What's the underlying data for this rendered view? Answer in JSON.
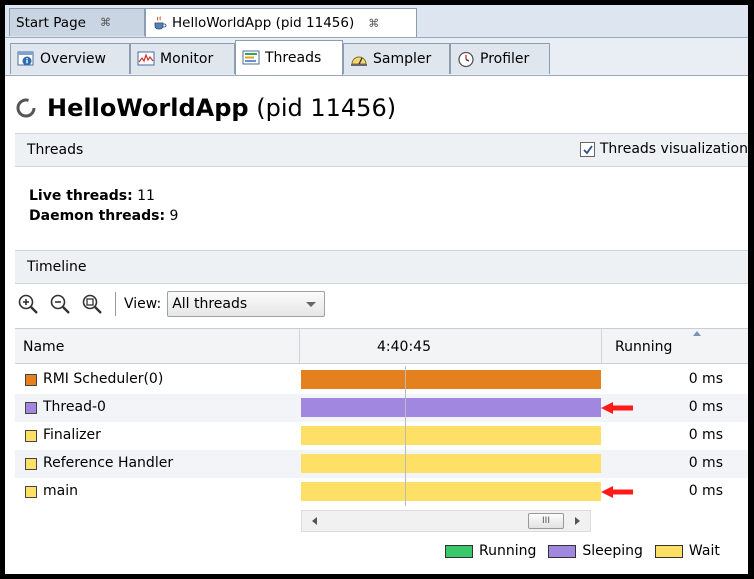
{
  "doc_tabs": [
    {
      "label": "Start Page",
      "active": false
    },
    {
      "label": "HelloWorldApp (pid 11456)",
      "active": true
    }
  ],
  "sub_tabs": [
    {
      "label": "Overview",
      "icon": "info-icon"
    },
    {
      "label": "Monitor",
      "icon": "monitor-chart-icon"
    },
    {
      "label": "Threads",
      "icon": "threads-icon",
      "active": true
    },
    {
      "label": "Sampler",
      "icon": "sampler-icon"
    },
    {
      "label": "Profiler",
      "icon": "profiler-clock-icon"
    }
  ],
  "app": {
    "name": "HelloWorldApp",
    "pid": "(pid 11456)"
  },
  "threads_section": {
    "title": "Threads",
    "checkbox_label": "Threads visualization",
    "checkbox_checked": true
  },
  "stats": {
    "live_label": "Live threads:",
    "live_value": "11",
    "daemon_label": "Daemon threads:",
    "daemon_value": "9"
  },
  "timeline": {
    "title": "Timeline",
    "view_label": "View:",
    "view_value": "All threads"
  },
  "table": {
    "col_name": "Name",
    "col_time": "4:40:45",
    "col_running": "Running",
    "rows": [
      {
        "name": "RMI Scheduler(0)",
        "color": "#e5801e",
        "running": "0 ms",
        "state": "Park"
      },
      {
        "name": "Thread-0",
        "color": "#a287e0",
        "running": "0 ms",
        "state": "Sleeping"
      },
      {
        "name": "Finalizer",
        "color": "#ffe066",
        "running": "0 ms",
        "state": "Wait"
      },
      {
        "name": "Reference Handler",
        "color": "#ffe066",
        "running": "0 ms",
        "state": "Wait"
      },
      {
        "name": "main",
        "color": "#ffe066",
        "running": "0 ms",
        "state": "Wait"
      }
    ]
  },
  "legend": [
    {
      "label": "Running",
      "color": "#3ac96a"
    },
    {
      "label": "Sleeping",
      "color": "#a287e0"
    },
    {
      "label": "Wait",
      "color": "#ffe066"
    }
  ],
  "colors": {
    "arrow": "#ff1a1a"
  }
}
